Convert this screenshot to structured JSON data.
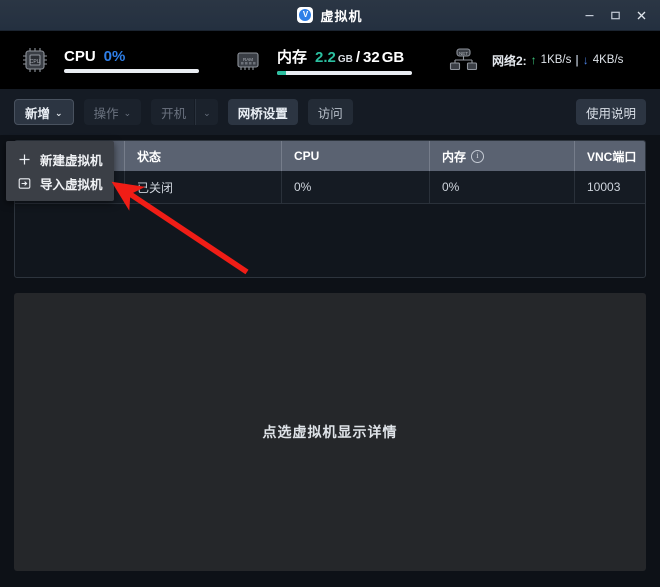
{
  "window": {
    "title": "虚拟机",
    "icon_name": "shield-v-icon",
    "controls": {
      "minimize": "minimize-icon",
      "maximize": "maximize-icon",
      "close": "close-icon"
    }
  },
  "stats": {
    "cpu": {
      "icon": "cpu-chip-icon",
      "label": "CPU",
      "value": "0%",
      "percent": 0
    },
    "memory": {
      "icon": "ram-chip-icon",
      "label": "内存",
      "used": "2.2",
      "used_unit": "GB",
      "separator": "/",
      "total": "32",
      "total_unit": "GB",
      "percent": 7
    },
    "network": {
      "icon": "network-icon",
      "label": "网络2:",
      "up_arrow": "↑",
      "up_value": "1KB/s",
      "pipe": "|",
      "down_arrow": "↓",
      "down_value": "4KB/s"
    }
  },
  "toolbar": {
    "add_label": "新增",
    "add_caret": "⌄",
    "action_label": "操作",
    "action_caret": "⌄",
    "power_label": "开机",
    "power_caret": "⌄",
    "bridge_label": "网桥设置",
    "access_label": "访问",
    "help_label": "使用说明"
  },
  "menu": {
    "items": [
      {
        "icon": "plus-icon",
        "glyph": "＋",
        "label": "新建虚拟机"
      },
      {
        "icon": "import-icon",
        "glyph": "⇲",
        "label": "导入虚拟机"
      }
    ]
  },
  "table": {
    "columns": [
      "",
      "状态",
      "CPU",
      "内存",
      "VNC端口"
    ],
    "memory_info_icon": "info-circle-icon",
    "rows": [
      {
        "name": "",
        "status": "已关闭",
        "cpu": "0%",
        "memory": "0%",
        "vnc_port": "10003"
      }
    ]
  },
  "detail": {
    "empty_text": "点选虚拟机显示详情"
  },
  "annotation": {
    "arrow_color": "#f01d16",
    "arrow_name": "red-pointer-arrow"
  },
  "colors": {
    "accent_blue": "#2f7fe8",
    "accent_green": "#2bbfa0",
    "header_gray": "#5a6271",
    "panel_dark": "#25272a"
  }
}
